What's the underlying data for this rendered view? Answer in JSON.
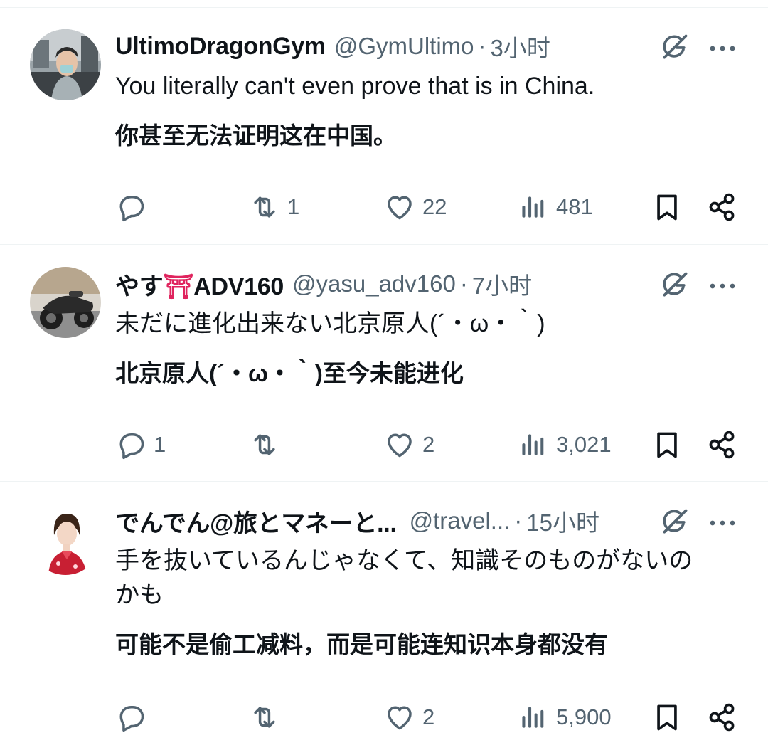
{
  "tweets": [
    {
      "display_name": "UltimoDragonGym",
      "handle": "@GymUltimo",
      "separator": "·",
      "time": "3小时",
      "text": "You literally can't even prove that is in China.",
      "translation": "你甚至无法证明这在中国。",
      "replies": "",
      "retweets": "1",
      "likes": "22",
      "views": "481"
    },
    {
      "display_name_prefix": "やす",
      "display_name_emoji": "⛩",
      "display_name_suffix": "ADV160",
      "handle": "@yasu_adv160",
      "separator": "·",
      "time": "7小时",
      "text": "未だに進化出来ない北京原人(´・ω・｀)",
      "translation": "北京原人(´・ω・｀)至今未能进化",
      "replies": "1",
      "retweets": "",
      "likes": "2",
      "views": "3,021"
    },
    {
      "display_name": "でんでん@旅とマネーと...",
      "handle": "@travel...",
      "separator": "·",
      "time": "15小时",
      "text_line1": "手を抜いているんじゃなくて、知識そのものがないの",
      "text_line2": "かも",
      "translation": "可能不是偷工减料，而是可能连知识本身都没有",
      "replies": "",
      "retweets": "",
      "likes": "2",
      "views": "5,900"
    }
  ],
  "icons": {
    "reply": "reply-icon",
    "retweet": "retweet-icon",
    "like": "heart-icon",
    "views": "views-icon",
    "bookmark": "bookmark-icon",
    "share": "share-icon",
    "grok": "grok-icon",
    "more": "more-icon"
  },
  "colors": {
    "text": "#0f1419",
    "secondary": "#536471",
    "divider": "#eff3f4",
    "torii": "#e0245e"
  }
}
